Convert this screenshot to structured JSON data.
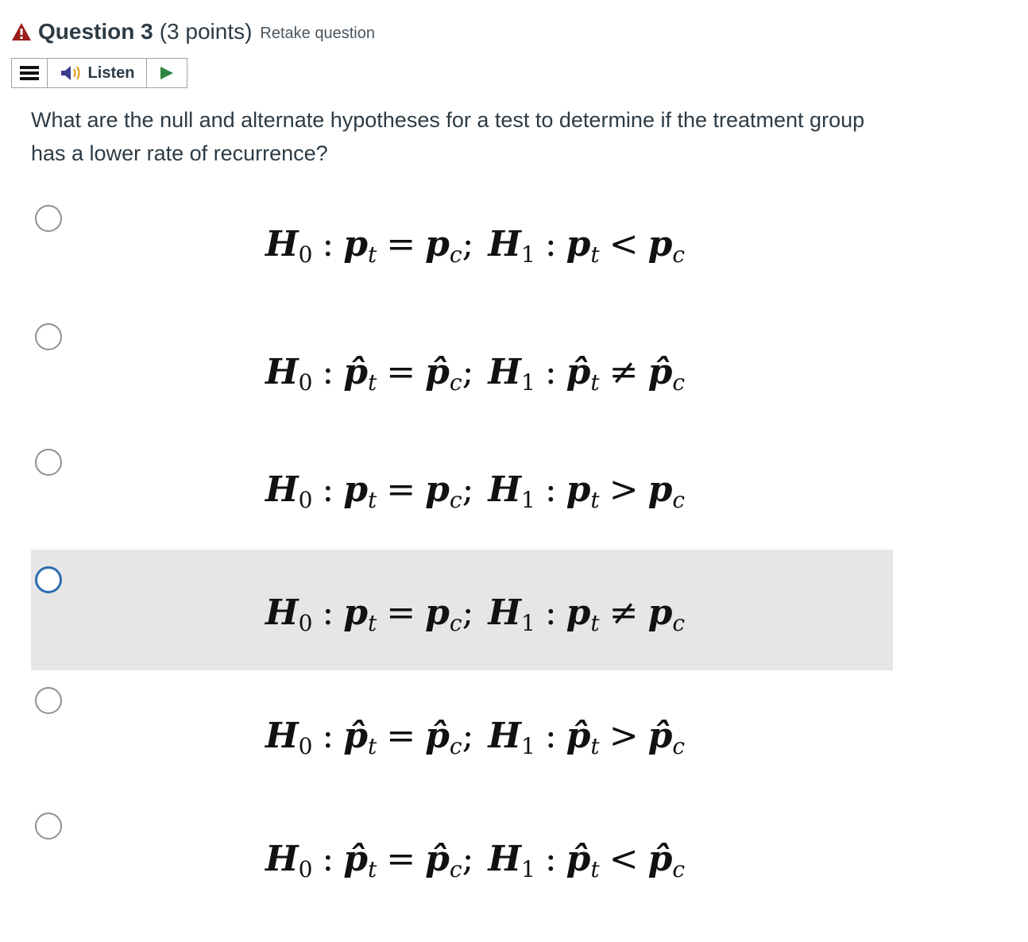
{
  "question": {
    "title": "Question 3",
    "points": "(3 points)",
    "retake": "Retake question",
    "warning_color": "#9b1c1c"
  },
  "toolbar": {
    "listen_label": "Listen",
    "play_color": "#2e8540"
  },
  "prompt": "What are the null and alternate hypotheses for a test to determine if the treatment group has a lower rate of recurrence?",
  "options": [
    {
      "h0_lhs": "p",
      "h0_rhs": "p",
      "hat": false,
      "h1_op": "<",
      "selected": false
    },
    {
      "h0_lhs": "p̂",
      "h0_rhs": "p̂",
      "hat": true,
      "h1_op": "≠",
      "selected": false
    },
    {
      "h0_lhs": "p",
      "h0_rhs": "p",
      "hat": false,
      "h1_op": ">",
      "selected": false
    },
    {
      "h0_lhs": "p",
      "h0_rhs": "p",
      "hat": false,
      "h1_op": "≠",
      "selected": true
    },
    {
      "h0_lhs": "p̂",
      "h0_rhs": "p̂",
      "hat": true,
      "h1_op": ">",
      "selected": false
    },
    {
      "h0_lhs": "p̂",
      "h0_rhs": "p̂",
      "hat": true,
      "h1_op": "<",
      "selected": false
    }
  ],
  "math": {
    "H": "H",
    "sub0": "0",
    "sub1": "1",
    "colon": ":",
    "eq": "=",
    "semi": ";",
    "t": "t",
    "c": "c"
  }
}
